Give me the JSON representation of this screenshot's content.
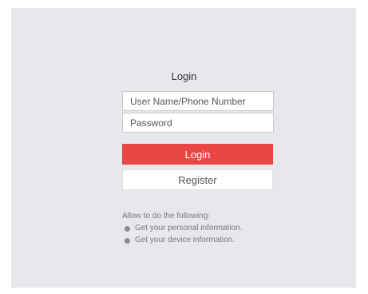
{
  "login": {
    "title": "Login",
    "username_placeholder": "User Name/Phone Number",
    "password_placeholder": "Password",
    "login_button": "Login",
    "register_button": "Register"
  },
  "permissions": {
    "heading": "Allow to do the following:",
    "items": [
      "Get your personal information.",
      "Get your device information."
    ]
  },
  "colors": {
    "panel_background": "#e7e8eb",
    "login_button": "#ea4645",
    "bullet": "#8c8c8c"
  },
  "icons": {
    "bullet": "bullet-dot-icon"
  }
}
